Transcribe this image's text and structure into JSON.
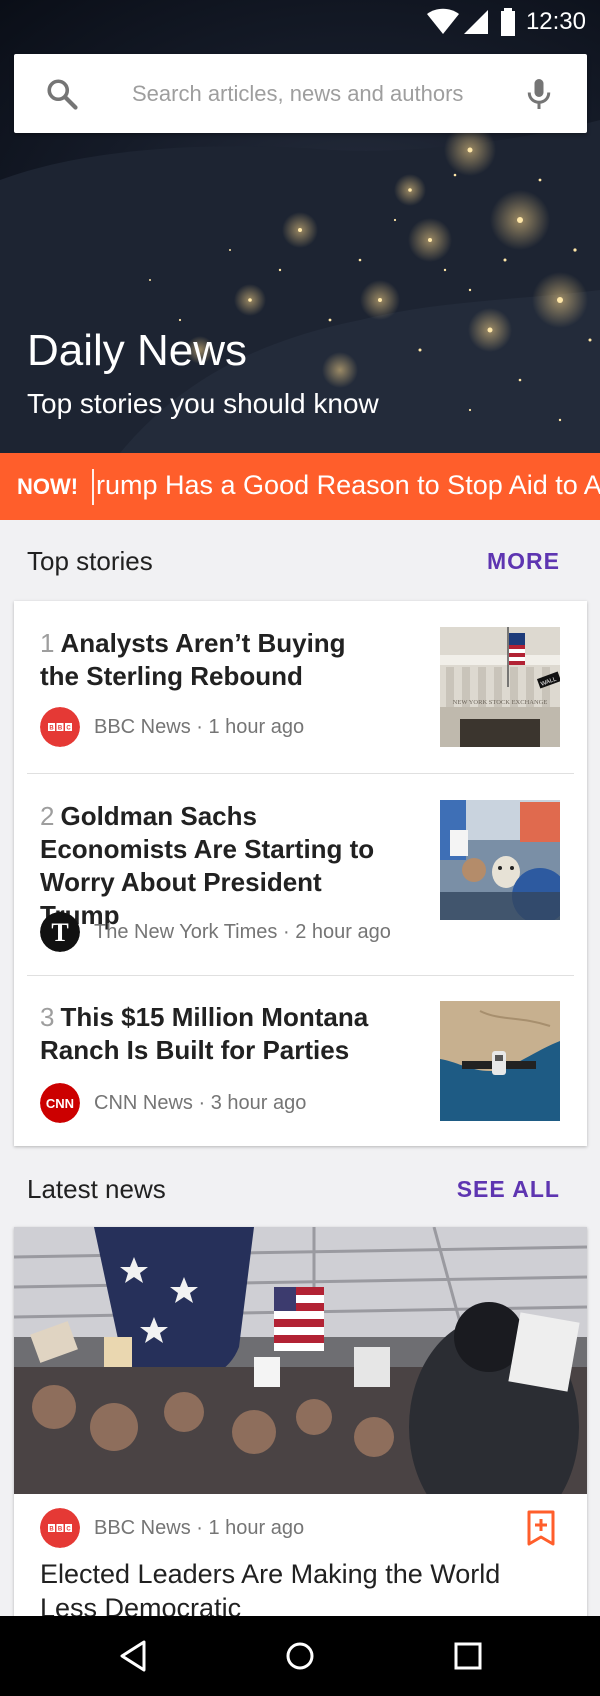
{
  "status": {
    "time": "12:30",
    "icons": [
      "wifi-icon",
      "signal-icon",
      "battery-icon"
    ]
  },
  "search": {
    "placeholder": "Search articles, news and authors",
    "value": ""
  },
  "hero": {
    "title": "Daily News",
    "subtitle": "Top stories you should know"
  },
  "ticker": {
    "label": "NOW!",
    "headline": "rump Has a Good Reason to Stop Aid to Af"
  },
  "top_stories": {
    "heading": "Top stories",
    "more_label": "MORE",
    "items": [
      {
        "rank": "1",
        "title": "Analysts Aren’t Buying the Sterling Rebound",
        "source": "BBC News",
        "time": "1 hour ago",
        "logo_text": "BBC"
      },
      {
        "rank": "2",
        "title": "Goldman Sachs Economists Are Starting to Worry About President Trump",
        "source": "The New York Times",
        "time": "2 hour ago",
        "logo_text": "T"
      },
      {
        "rank": "3",
        "title": "This $15 Million Montana Ranch Is Built for Parties",
        "source": "CNN News",
        "time": "3 hour ago",
        "logo_text": "CNN"
      }
    ],
    "thumbs": {
      "stock_exchange_sign": "NEW YORK STOCK EXCHANGE",
      "wall_sign": "WALL"
    }
  },
  "latest_news": {
    "heading": "Latest news",
    "see_all_label": "SEE ALL",
    "item": {
      "source": "BBC News",
      "time": "1 hour ago",
      "logo_text": "BBC",
      "title": "Elected Leaders Are Making the World Less Democratic"
    }
  },
  "separator": "·",
  "colors": {
    "accent": "#ff5e2b",
    "link": "#5e35b1",
    "bbc": "#e53935",
    "cnn": "#cc0000"
  }
}
